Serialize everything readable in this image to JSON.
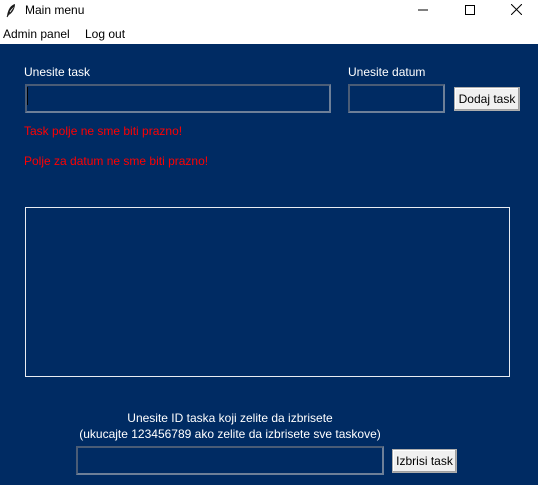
{
  "window": {
    "title": "Main menu",
    "icon": "feather-icon",
    "controls": [
      "minimize-icon",
      "maximize-icon",
      "close-icon"
    ]
  },
  "menu": {
    "admin_panel": "Admin panel",
    "log_out": "Log out"
  },
  "task_form": {
    "task_label": "Unesite task",
    "task_value": "",
    "date_label": "Unesite datum",
    "date_value": "",
    "add_button": "Dodaj task",
    "errors": {
      "task_empty": "Task polje ne sme biti prazno!",
      "date_empty": "Polje za datum ne sme biti prazno!"
    }
  },
  "task_list": {
    "items": []
  },
  "delete_form": {
    "instruction_line1": "Unesite ID taska koji zelite da izbrisete",
    "instruction_line2": "(ukucajte 123456789 ako zelite da izbrisete sve taskove)",
    "id_value": "",
    "delete_button": "Izbrisi task"
  },
  "colors": {
    "background": "#002b63",
    "label_text": "#ffffff",
    "error_text": "#ff0000",
    "button_face": "#f0f0f0"
  }
}
